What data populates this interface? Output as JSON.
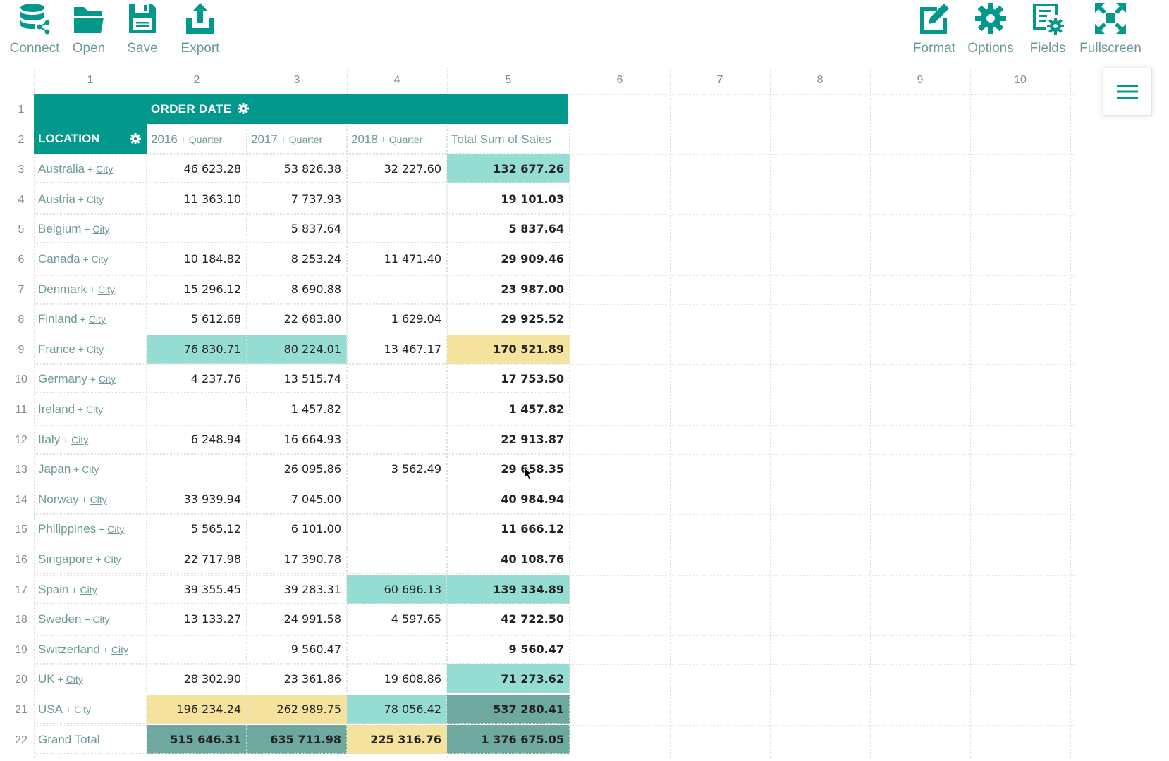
{
  "toolbar": {
    "left": [
      {
        "label": "Connect",
        "icon": "database-share-icon"
      },
      {
        "label": "Open",
        "icon": "folder-open-icon"
      },
      {
        "label": "Save",
        "icon": "floppy-disk-icon"
      },
      {
        "label": "Export",
        "icon": "export-upload-icon"
      }
    ],
    "right": [
      {
        "label": "Format",
        "icon": "edit-square-icon"
      },
      {
        "label": "Options",
        "icon": "gear-icon"
      },
      {
        "label": "Fields",
        "icon": "fields-settings-icon"
      },
      {
        "label": "Fullscreen",
        "icon": "fullscreen-icon"
      }
    ]
  },
  "menu_button": {
    "icon": "hamburger-menu-icon"
  },
  "column_headers": [
    "1",
    "2",
    "3",
    "4",
    "5",
    "6",
    "7",
    "8",
    "9",
    "10"
  ],
  "row_headers": [
    "1",
    "2",
    "3",
    "4",
    "5",
    "6",
    "7",
    "8",
    "9",
    "10",
    "11",
    "12",
    "13",
    "14",
    "15",
    "16",
    "17",
    "18",
    "19",
    "20",
    "21",
    "22"
  ],
  "pivot": {
    "column_field": "ORDER DATE",
    "row_field": "LOCATION",
    "columns": [
      {
        "year": "2016",
        "drill": "Quarter"
      },
      {
        "year": "2017",
        "drill": "Quarter"
      },
      {
        "year": "2018",
        "drill": "Quarter"
      }
    ],
    "total_header": "Total Sum of Sales",
    "drill_row": "City",
    "rows": [
      {
        "label": "Australia",
        "values": [
          "46 623.28",
          "53 826.38",
          "32 227.60",
          "132 677.26"
        ],
        "highlight": [
          "",
          "",
          "",
          "teal"
        ]
      },
      {
        "label": "Austria",
        "values": [
          "11 363.10",
          "7 737.93",
          "",
          "19 101.03"
        ],
        "highlight": [
          "",
          "",
          "",
          ""
        ]
      },
      {
        "label": "Belgium",
        "values": [
          "",
          "5 837.64",
          "",
          "5 837.64"
        ],
        "highlight": [
          "",
          "",
          "",
          ""
        ]
      },
      {
        "label": "Canada",
        "values": [
          "10 184.82",
          "8 253.24",
          "11 471.40",
          "29 909.46"
        ],
        "highlight": [
          "",
          "",
          "",
          ""
        ]
      },
      {
        "label": "Denmark",
        "values": [
          "15 296.12",
          "8 690.88",
          "",
          "23 987.00"
        ],
        "highlight": [
          "",
          "",
          "",
          ""
        ]
      },
      {
        "label": "Finland",
        "values": [
          "5 612.68",
          "22 683.80",
          "1 629.04",
          "29 925.52"
        ],
        "highlight": [
          "",
          "",
          "",
          ""
        ]
      },
      {
        "label": "France",
        "values": [
          "76 830.71",
          "80 224.01",
          "13 467.17",
          "170 521.89"
        ],
        "highlight": [
          "teal",
          "teal",
          "",
          "yellow"
        ]
      },
      {
        "label": "Germany",
        "values": [
          "4 237.76",
          "13 515.74",
          "",
          "17 753.50"
        ],
        "highlight": [
          "",
          "",
          "",
          ""
        ]
      },
      {
        "label": "Ireland",
        "values": [
          "",
          "1 457.82",
          "",
          "1 457.82"
        ],
        "highlight": [
          "",
          "",
          "",
          ""
        ]
      },
      {
        "label": "Italy",
        "values": [
          "6 248.94",
          "16 664.93",
          "",
          "22 913.87"
        ],
        "highlight": [
          "",
          "",
          "",
          ""
        ]
      },
      {
        "label": "Japan",
        "values": [
          "",
          "26 095.86",
          "3 562.49",
          "29 658.35"
        ],
        "highlight": [
          "",
          "",
          "",
          ""
        ]
      },
      {
        "label": "Norway",
        "values": [
          "33 939.94",
          "7 045.00",
          "",
          "40 984.94"
        ],
        "highlight": [
          "",
          "",
          "",
          ""
        ]
      },
      {
        "label": "Philippines",
        "values": [
          "5 565.12",
          "6 101.00",
          "",
          "11 666.12"
        ],
        "highlight": [
          "",
          "",
          "",
          ""
        ]
      },
      {
        "label": "Singapore",
        "values": [
          "22 717.98",
          "17 390.78",
          "",
          "40 108.76"
        ],
        "highlight": [
          "",
          "",
          "",
          ""
        ]
      },
      {
        "label": "Spain",
        "values": [
          "39 355.45",
          "39 283.31",
          "60 696.13",
          "139 334.89"
        ],
        "highlight": [
          "",
          "",
          "teal",
          "teal"
        ]
      },
      {
        "label": "Sweden",
        "values": [
          "13 133.27",
          "24 991.58",
          "4 597.65",
          "42 722.50"
        ],
        "highlight": [
          "",
          "",
          "",
          ""
        ]
      },
      {
        "label": "Switzerland",
        "values": [
          "",
          "9 560.47",
          "",
          "9 560.47"
        ],
        "highlight": [
          "",
          "",
          "",
          ""
        ]
      },
      {
        "label": "UK",
        "values": [
          "28 302.90",
          "23 361.86",
          "19 608.86",
          "71 273.62"
        ],
        "highlight": [
          "",
          "",
          "",
          "teal"
        ]
      },
      {
        "label": "USA",
        "values": [
          "196 234.24",
          "262 989.75",
          "78 056.42",
          "537 280.41"
        ],
        "highlight": [
          "yellow",
          "yellow",
          "teal",
          "dark"
        ]
      }
    ],
    "grand_total": {
      "label": "Grand Total",
      "values": [
        "515 646.31",
        "635 711.98",
        "225 316.76",
        "1 376 675.05"
      ],
      "highlight": [
        "dark",
        "dark",
        "yellow",
        "dark"
      ]
    }
  },
  "colors": {
    "accent": "#02988c",
    "icon": "#02988c",
    "label": "#6b9b98",
    "highlight_teal": "#95ddd3",
    "highlight_yellow": "#f5e29c",
    "highlight_dark": "#6fa89e"
  }
}
